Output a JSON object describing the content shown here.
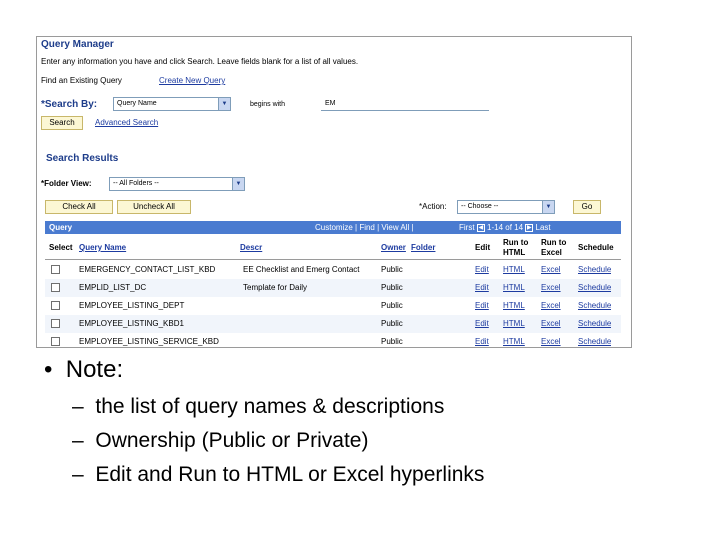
{
  "screenshot": {
    "title": "Query Manager",
    "instructions": "Enter any information you have and click Search. Leave fields blank for a list of all values.",
    "find_existing": "Find an Existing Query",
    "create_new": "Create New Query",
    "search_by_label": "*Search By:",
    "search_by_value": "Query Name",
    "begins_with": "begins with",
    "search_value": "EM",
    "search_button": "Search",
    "advanced_search": "Advanced Search",
    "search_results": "Search Results",
    "folder_view_label": "*Folder View:",
    "folder_view_value": "-- All Folders --",
    "check_all": "Check All",
    "uncheck_all": "Uncheck All",
    "action_label": "*Action:",
    "action_value": "-- Choose --",
    "go_button": "Go",
    "grid": {
      "title": "Query",
      "nav": "Customize | Find | View All |",
      "first": "First",
      "page": "1-14 of 14",
      "last": "Last"
    },
    "columns": {
      "select": "Select",
      "query_name": "Query Name",
      "descr": "Descr",
      "owner": "Owner",
      "folder": "Folder",
      "edit": "Edit",
      "run_html_1": "Run to",
      "run_html_2": "HTML",
      "run_excel_1": "Run to",
      "run_excel_2": "Excel",
      "schedule": "Schedule"
    },
    "rows": [
      {
        "name": "EMERGENCY_CONTACT_LIST_KBD",
        "descr": "EE Checklist and Emerg Contact",
        "owner": "Public",
        "edit": "Edit",
        "html": "HTML",
        "excel": "Excel",
        "schedule": "Schedule"
      },
      {
        "name": "EMPLID_LIST_DC",
        "descr": "Template for Daily",
        "owner": "Public",
        "edit": "Edit",
        "html": "HTML",
        "excel": "Excel",
        "schedule": "Schedule"
      },
      {
        "name": "EMPLOYEE_LISTING_DEPT",
        "descr": "",
        "owner": "Public",
        "edit": "Edit",
        "html": "HTML",
        "excel": "Excel",
        "schedule": "Schedule"
      },
      {
        "name": "EMPLOYEE_LISTING_KBD1",
        "descr": "",
        "owner": "Public",
        "edit": "Edit",
        "html": "HTML",
        "excel": "Excel",
        "schedule": "Schedule"
      },
      {
        "name": "EMPLOYEE_LISTING_SERVICE_KBD",
        "descr": "",
        "owner": "Public",
        "edit": "Edit",
        "html": "HTML",
        "excel": "Excel",
        "schedule": "Schedule"
      }
    ]
  },
  "notes": {
    "bullet_marker": "•",
    "heading": "Note:",
    "dash": "–",
    "items": [
      "the list of query names & descriptions",
      "Ownership (Public or Private)",
      "Edit and Run to HTML or Excel hyperlinks"
    ]
  },
  "colors": {
    "header_blue": "#1d3c8a",
    "link_blue": "#1d3ba0",
    "grid_bar": "#4a7bd0",
    "button_bg": "#fcf7d4"
  }
}
